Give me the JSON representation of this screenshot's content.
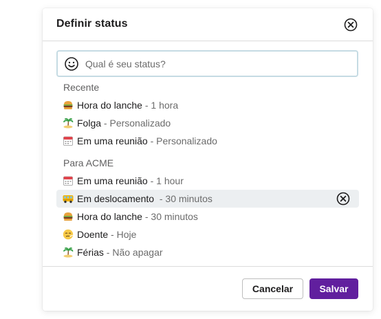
{
  "dialog": {
    "title": "Definir status",
    "close_icon": "close-circle-icon"
  },
  "search": {
    "placeholder": "Qual é seu status?",
    "value": "",
    "emoji_icon": "smiley-icon"
  },
  "recent": {
    "label": "Recente",
    "items": [
      {
        "icon": "hamburger-icon",
        "name": "Hora do lanche",
        "separator": " - ",
        "expiry": "1 hora"
      },
      {
        "icon": "island-icon",
        "name": "Folga",
        "separator": " - ",
        "expiry": "Personalizado"
      },
      {
        "icon": "calendar-icon",
        "name": "Em uma reunião",
        "separator": " - ",
        "expiry": "Personalizado"
      }
    ]
  },
  "workspace": {
    "label": "Para ACME",
    "items": [
      {
        "icon": "calendar-icon",
        "name": "Em uma reunião",
        "separator": " - ",
        "expiry": "1 hour"
      },
      {
        "icon": "bus-icon",
        "name": "Em deslocamento",
        "separator": "  - ",
        "expiry": "30 minutos",
        "highlighted": true,
        "clear_icon": "close-circle-icon"
      },
      {
        "icon": "hamburger-icon",
        "name": "Hora do lanche",
        "separator": " - ",
        "expiry": "30 minutos"
      },
      {
        "icon": "sick-face-icon",
        "name": "Doente",
        "separator": " - ",
        "expiry": "Hoje"
      },
      {
        "icon": "island-icon",
        "name": "Férias",
        "separator": " - ",
        "expiry": "Não apagar"
      }
    ]
  },
  "footer": {
    "cancel_label": "Cancelar",
    "save_label": "Salvar"
  },
  "colors": {
    "primary": "#611f9e",
    "highlight_row": "#eceff1",
    "search_border": "#c5dbe3",
    "muted_text": "#6b6b6b"
  }
}
